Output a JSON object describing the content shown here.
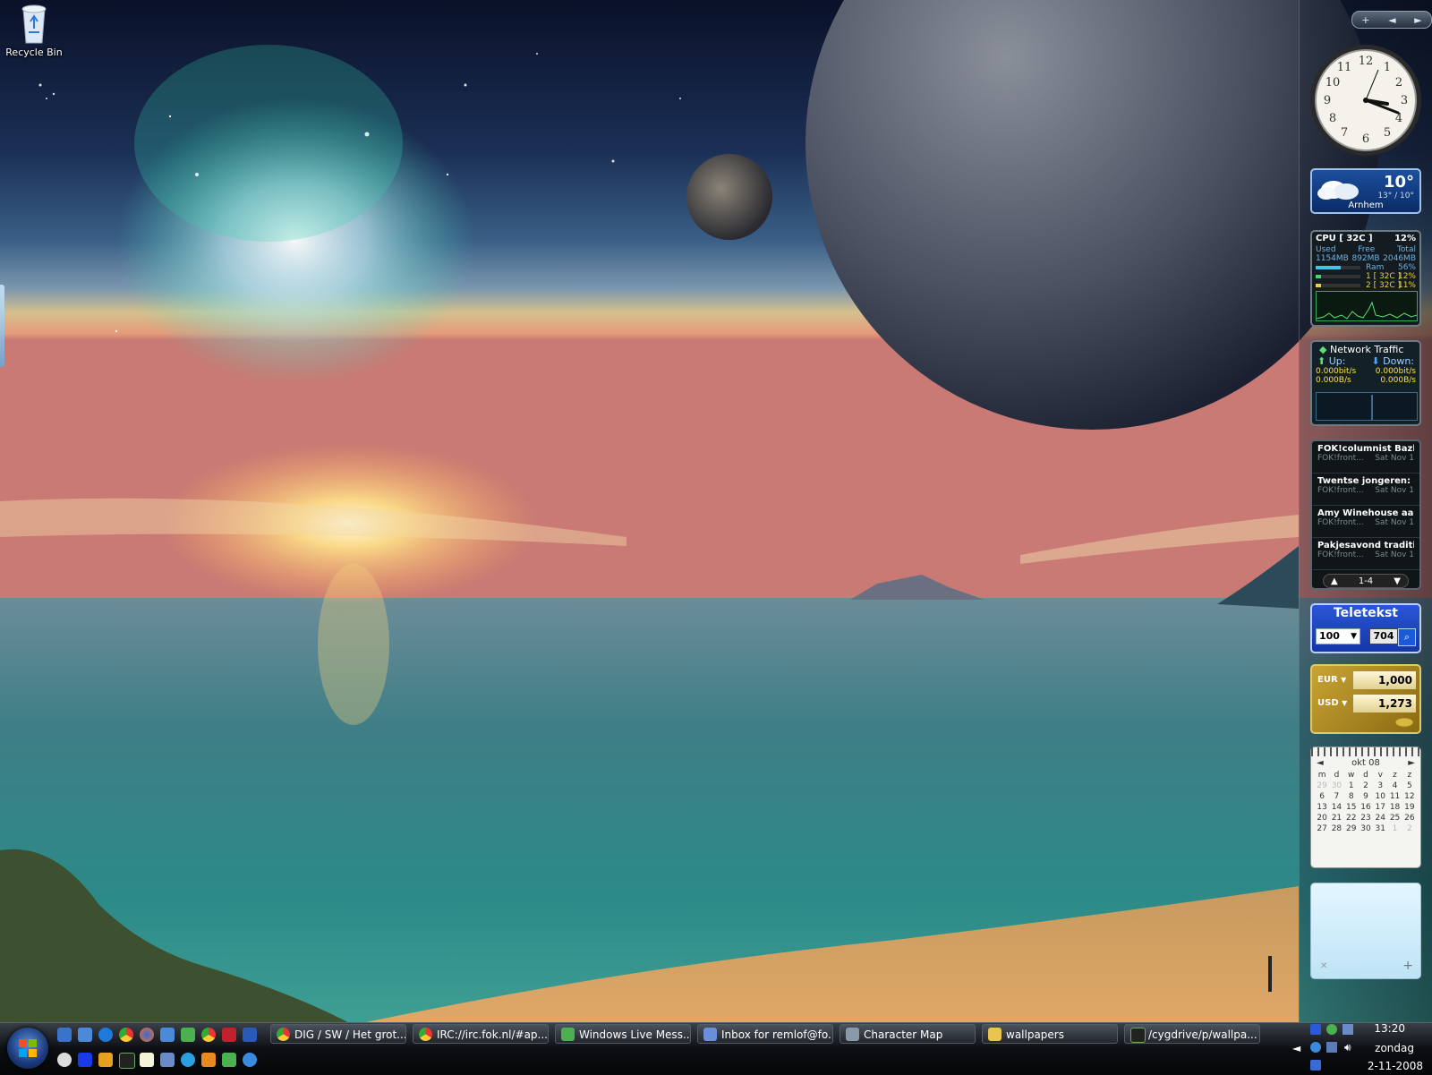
{
  "desktop": {
    "recycle_bin_label": "Recycle Bin"
  },
  "sidebar": {
    "controls": {
      "add": "+",
      "prev": "◄",
      "next": "►"
    },
    "clock": {
      "time": "13:20"
    },
    "weather": {
      "temp": "10°",
      "range": "13° / 10°",
      "city": "Arnhem"
    },
    "cpu": {
      "title": "CPU [ 32C ]",
      "percent": "12%",
      "used_label": "Used",
      "free_label": "Free",
      "total_label": "Total",
      "used": "1154MB",
      "free": "892MB",
      "total": "2046MB",
      "ram_label": "Ram",
      "ram_pct": "56%",
      "core1_label": "1 [ 32C ]",
      "core1_pct": "12%",
      "core2_label": "2 [ 32C ]",
      "core2_pct": "11%",
      "ram_level": 0.56,
      "core1_level": 0.12,
      "core2_level": 0.11
    },
    "network": {
      "title": "Network Traffic",
      "up_label": "Up:",
      "down_label": "Down:",
      "up_bits": "0.000bit/s",
      "down_bits": "0.000bit/s",
      "up_bytes": "0.000B/s",
      "down_bytes": "0.000B/s"
    },
    "feed": {
      "items": [
        {
          "title": "FOK!columnist Bazb...",
          "source": "FOK!front...",
          "date": "Sat Nov 1"
        },
        {
          "title": "Twentse jongeren: S...",
          "source": "FOK!front...",
          "date": "Sat Nov 1"
        },
        {
          "title": "Amy Winehouse aan...",
          "source": "FOK!front...",
          "date": "Sat Nov 1"
        },
        {
          "title": "Pakjesavond traditie ...",
          "source": "FOK!front...",
          "date": "Sat Nov 1"
        }
      ],
      "pager": "1-4"
    },
    "teletekst": {
      "title": "Teletekst",
      "page": "100",
      "sub": "704"
    },
    "currency": {
      "from_code": "EUR",
      "from_value": "1,000",
      "to_code": "USD",
      "to_value": "1,273"
    },
    "calendar": {
      "month": "okt 08",
      "weekdays": [
        "m",
        "d",
        "w",
        "d",
        "v",
        "z",
        "z"
      ],
      "rows": [
        [
          "29",
          "30",
          "1",
          "2",
          "3",
          "4",
          "5"
        ],
        [
          "6",
          "7",
          "8",
          "9",
          "10",
          "11",
          "12"
        ],
        [
          "13",
          "14",
          "15",
          "16",
          "17",
          "18",
          "19"
        ],
        [
          "20",
          "21",
          "22",
          "23",
          "24",
          "25",
          "26"
        ],
        [
          "27",
          "28",
          "29",
          "30",
          "31",
          "1",
          "2"
        ]
      ]
    },
    "notes": {
      "close": "✕",
      "add": "+"
    }
  },
  "taskbar": {
    "tasks": [
      {
        "label": "DIG / SW / Het grot...",
        "icon": "chrome-icon",
        "color": "#e8a020"
      },
      {
        "label": "IRC://irc.fok.nl/#ap...",
        "icon": "chrome-icon",
        "color": "#4a90e2"
      },
      {
        "label": "Windows Live Mess...",
        "icon": "messenger-icon",
        "color": "#4caf50"
      },
      {
        "label": "Inbox for remlof@fo...",
        "icon": "mail-icon",
        "color": "#6a8fd8"
      },
      {
        "label": "Character Map",
        "icon": "charmap-icon",
        "color": "#88a"
      },
      {
        "label": "wallpapers",
        "icon": "folder-icon",
        "color": "#e8c450"
      },
      {
        "label": "/cygdrive/p/wallpa...",
        "icon": "terminal-icon",
        "color": "#222"
      }
    ],
    "clock": {
      "time": "13:20",
      "day": "zondag",
      "date": "2-11-2008"
    }
  }
}
